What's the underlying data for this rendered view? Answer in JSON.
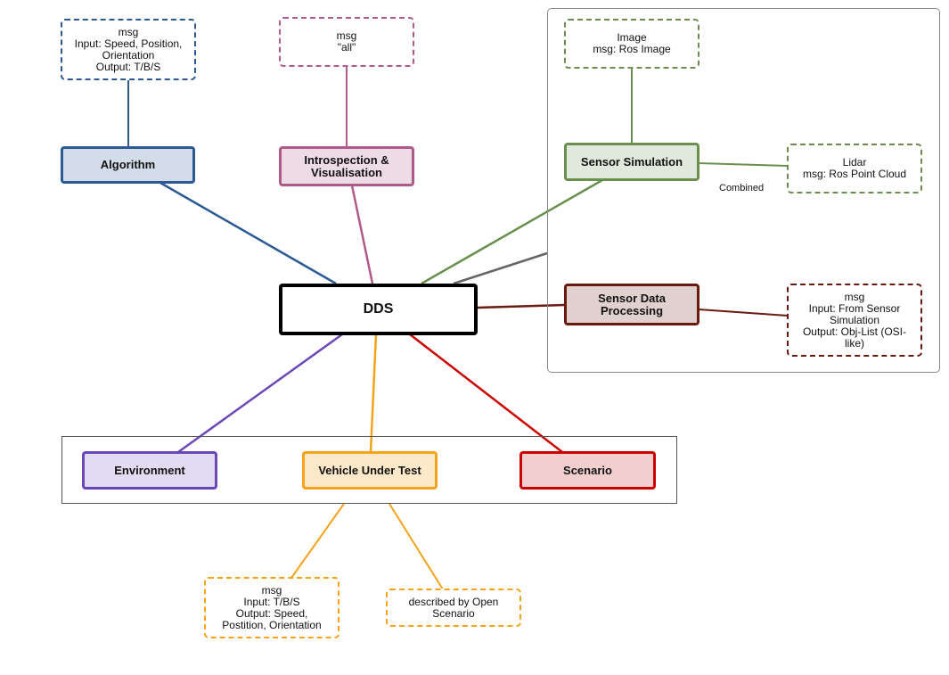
{
  "diagram": {
    "center": {
      "label": "DDS",
      "color": "#000000",
      "fill": "#ffffff"
    },
    "nodes": {
      "algorithm": {
        "label": "Algorithm",
        "color": "#2b5a94",
        "fill": "#d3dde9"
      },
      "introspection": {
        "label": "Introspection &\nVisualisation",
        "color": "#b05a8a",
        "fill": "#eddbe5"
      },
      "sensor_simulation": {
        "label": "Sensor Simulation",
        "color": "#6a8f4f",
        "fill": "#e1e9dc"
      },
      "sensor_data_processing": {
        "label": "Sensor Data\nProcessing",
        "color": "#6b1a10",
        "fill": "#e0d1cf"
      },
      "environment": {
        "label": "Environment",
        "color": "#6c47b8",
        "fill": "#e2dbf1"
      },
      "vehicle_under_test": {
        "label": "Vehicle Under Test",
        "color": "#f5a31a",
        "fill": "#fde8c9"
      },
      "scenario": {
        "label": "Scenario",
        "color": "#cc0000",
        "fill": "#f3cece"
      }
    },
    "notes": {
      "algorithm_msg": "msg\nInput: Speed, Position,\nOrientation\nOutput: T/B/S",
      "introspection_msg": "msg\n\"all\"",
      "image_msg": "Image\nmsg: Ros Image",
      "lidar_msg": "Lidar\nmsg: Ros Point Cloud",
      "sdp_msg": "msg\nInput: From Sensor\nSimulation\nOutput: Obj-List (OSI-\nlike)",
      "vut_msg": "msg\nInput: T/B/S\nOutput: Speed,\nPostition, Orientation",
      "scenario_note": "described by Open\nScenario"
    },
    "edge_labels": {
      "combined": "Combined"
    },
    "colors": {
      "sensor_group_edge": "#666666",
      "group_border": "#888888"
    }
  }
}
